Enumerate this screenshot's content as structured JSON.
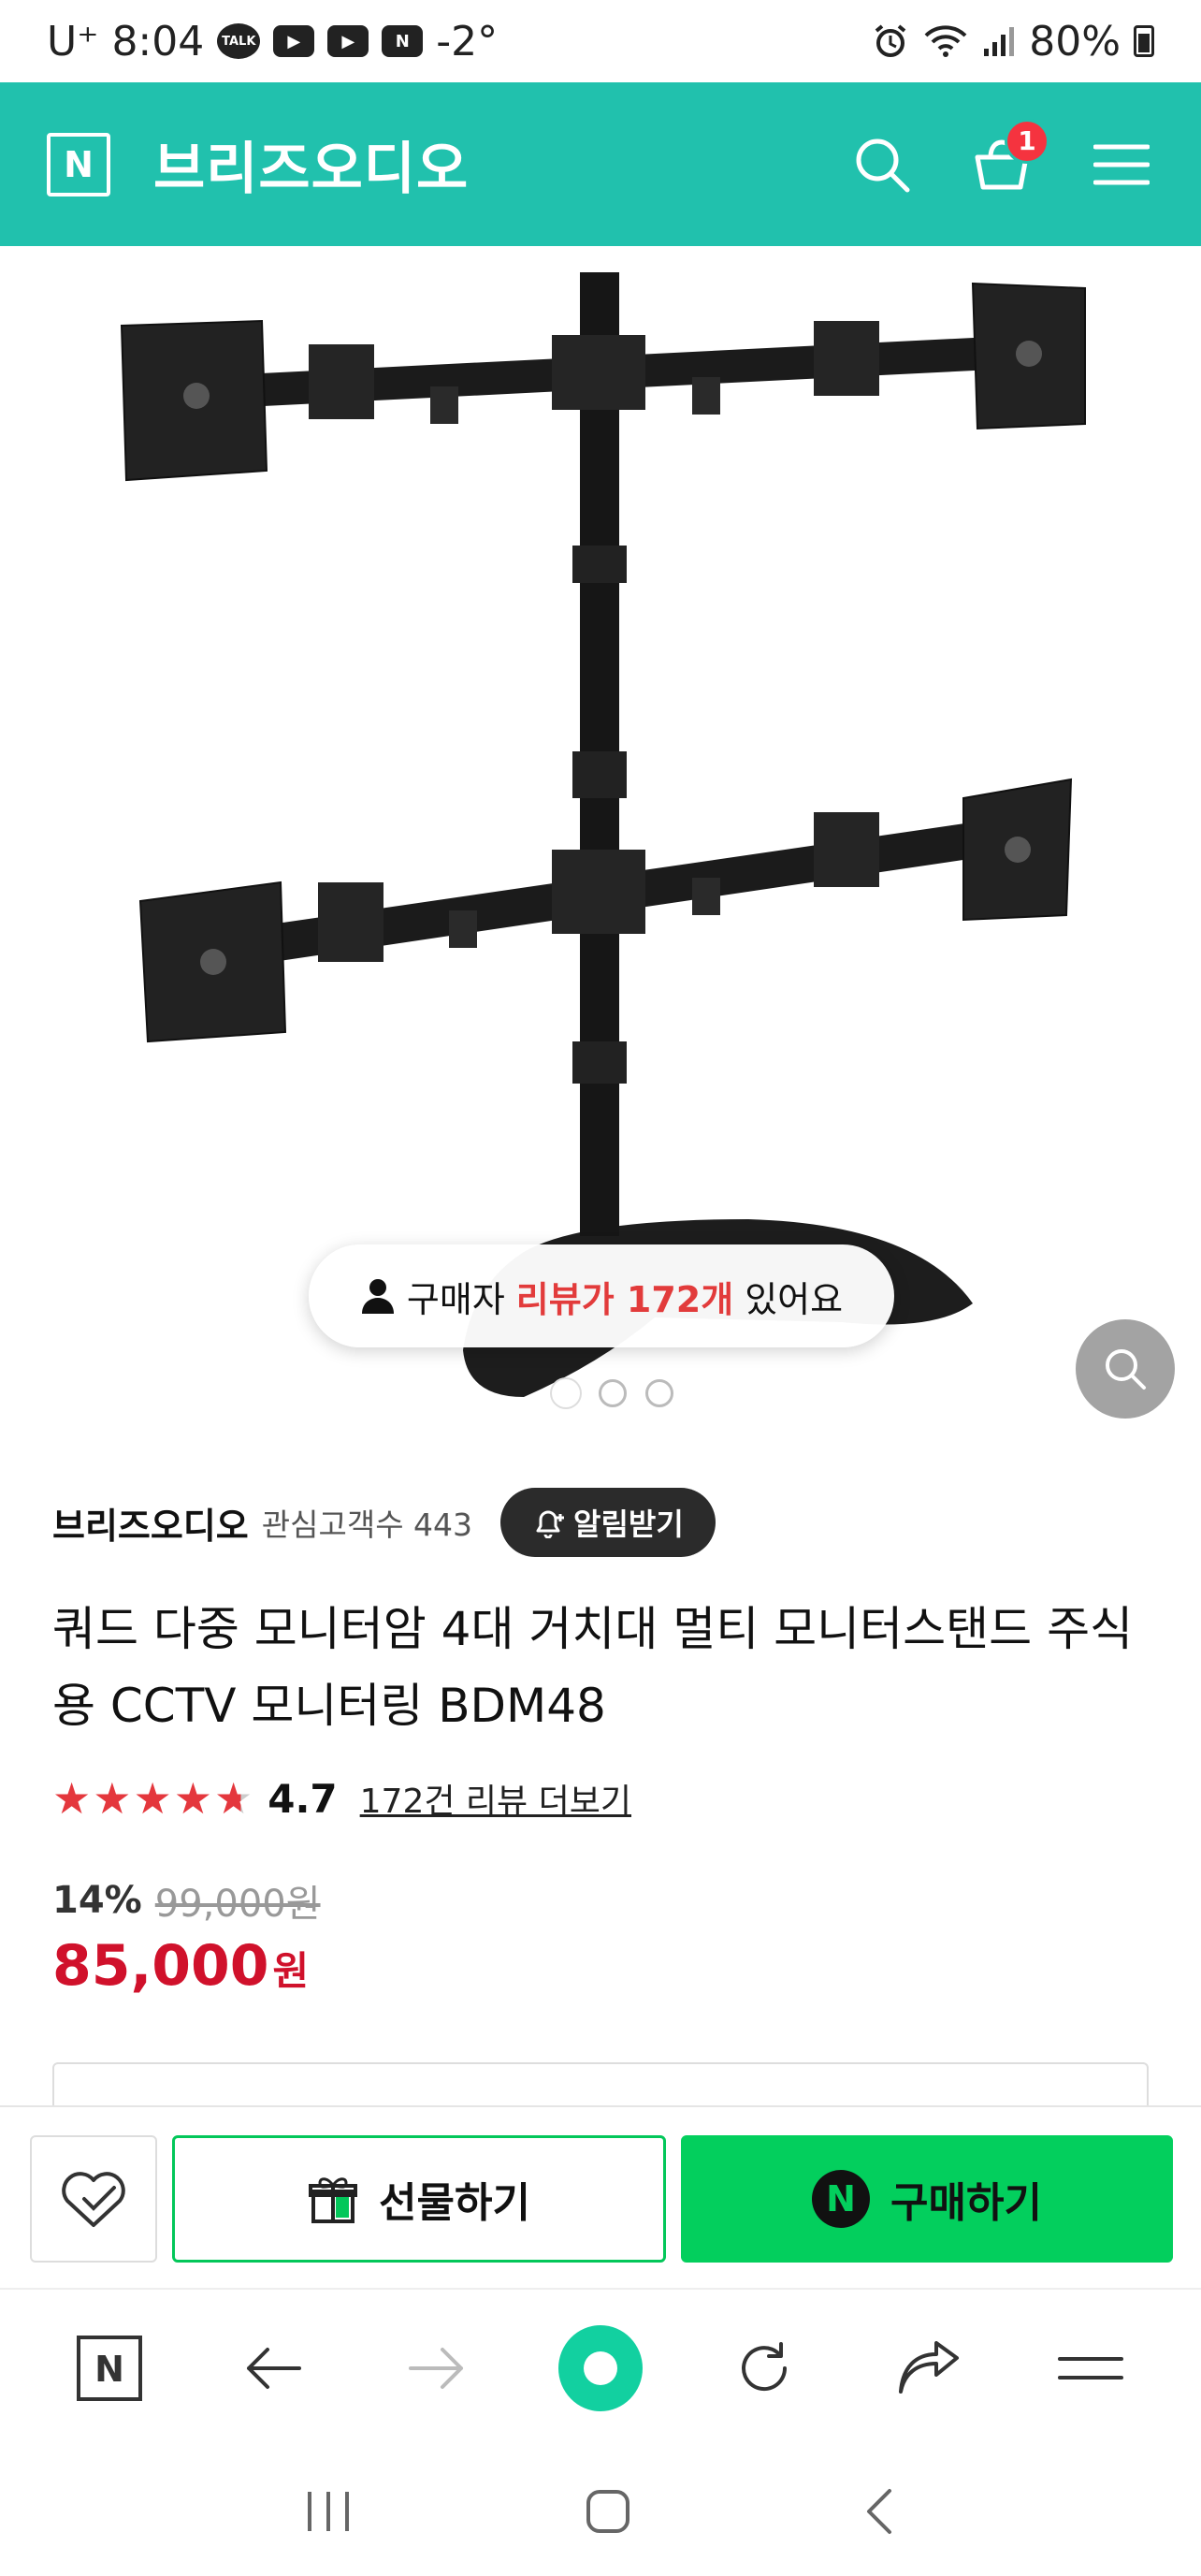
{
  "status_bar": {
    "carrier": "U⁺",
    "time": "8:04",
    "talk_label": "TALK",
    "n_label": "N",
    "temperature": "-2°",
    "battery": "80%"
  },
  "header": {
    "logo_letter": "N",
    "store_name": "브리즈오디오",
    "cart_count": "1"
  },
  "gallery": {
    "review_prefix": "구매자",
    "review_highlight": "리뷰가 172개",
    "review_suffix": "있어요",
    "page_count": 3,
    "current_page": 1
  },
  "product": {
    "store": "브리즈오디오",
    "fans_label": "관심고객수 443",
    "alarm_label": "알림받기",
    "title": "쿼드 다중 모니터암 4대 거치대 멀티 모니터스탠드 주식용 CCTV 모니터링 BDM48",
    "rating": "4.7",
    "rating_value": 4.7,
    "review_link": "172건 리뷰 더보기",
    "discount": "14%",
    "original_price": "99,000원",
    "sale_price": "85,000",
    "currency": "원"
  },
  "actions": {
    "gift_label": "선물하기",
    "buy_label": "구매하기",
    "npay_letter": "N"
  },
  "browser_bar": {
    "logo_letter": "N"
  },
  "colors": {
    "brand_teal": "#21c1ad",
    "buy_green": "#03cf5d",
    "sale_red": "#d0112b",
    "star_red": "#e4373d",
    "badge_red": "#f5333f"
  },
  "icons": [
    "search-icon",
    "cart-icon",
    "menu-icon",
    "zoom-icon",
    "bell-icon",
    "heart-check-icon",
    "gift-icon",
    "back-icon",
    "forward-icon",
    "refresh-icon",
    "share-icon"
  ]
}
